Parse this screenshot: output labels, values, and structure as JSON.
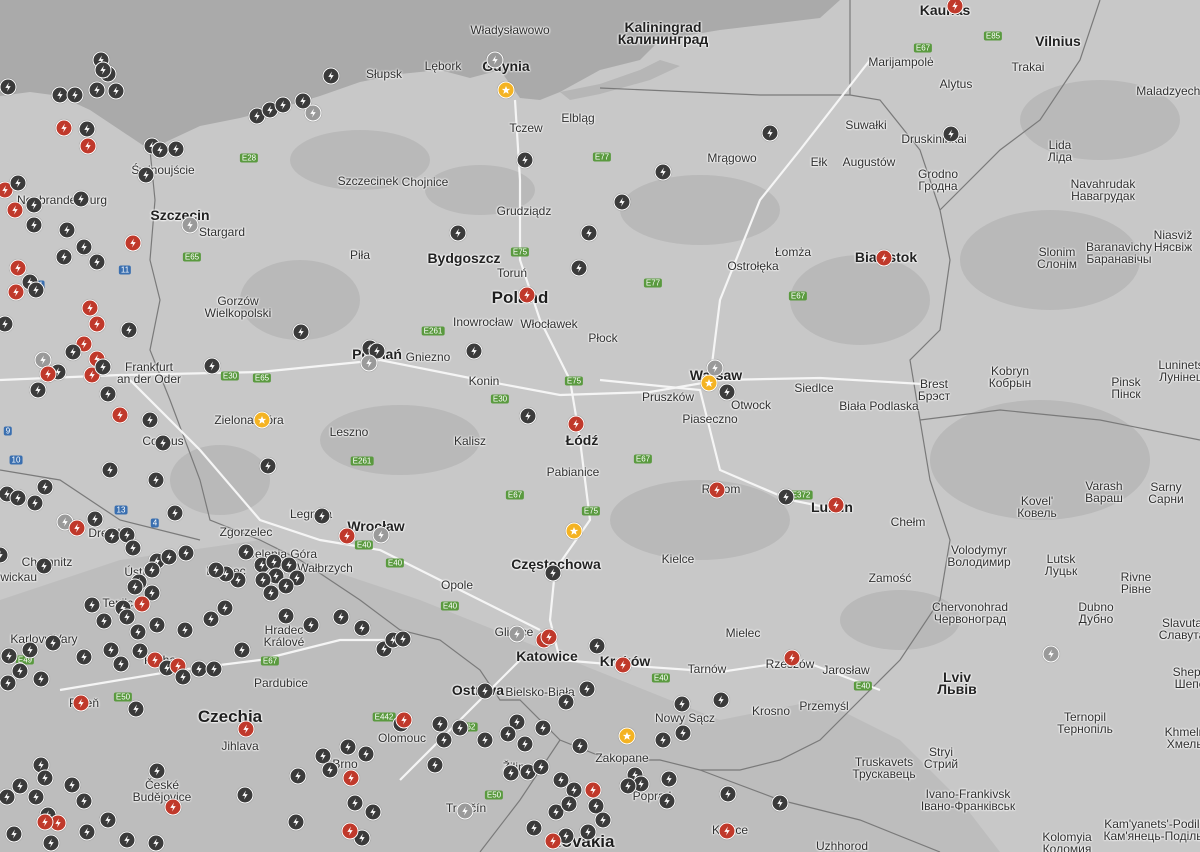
{
  "map": {
    "country_labels": [
      {
        "id": "poland",
        "text": "Poland"
      },
      {
        "id": "czechia",
        "text": "Czechia"
      },
      {
        "id": "slovakia",
        "text": "Slovakia"
      }
    ],
    "city_labels": [
      {
        "id": "wladyslawowo",
        "text": "Władysławowo"
      },
      {
        "id": "kaliningrad",
        "text": "Kaliningrad\nКалининград"
      },
      {
        "id": "vilnius",
        "text": "Vilnius"
      },
      {
        "id": "gdynia",
        "text": "Gdynia"
      },
      {
        "id": "slupsk",
        "text": "Słupsk"
      },
      {
        "id": "lebork",
        "text": "Lębork"
      },
      {
        "id": "elblag",
        "text": "Elbląg"
      },
      {
        "id": "tczew",
        "text": "Tczew"
      },
      {
        "id": "marijampole",
        "text": "Marijampolė"
      },
      {
        "id": "alytus",
        "text": "Alytus"
      },
      {
        "id": "trakai",
        "text": "Trakai"
      },
      {
        "id": "maladzyechna",
        "text": "Maladzyechna"
      },
      {
        "id": "suwalki",
        "text": "Suwałki"
      },
      {
        "id": "druskininkai",
        "text": "Druskininkai"
      },
      {
        "id": "lida",
        "text": "Lida\nЛіда"
      },
      {
        "id": "mragowo",
        "text": "Mrągowo"
      },
      {
        "id": "elk",
        "text": "Ełk"
      },
      {
        "id": "augustow",
        "text": "Augustów"
      },
      {
        "id": "grodno",
        "text": "Grodno\nГродна"
      },
      {
        "id": "navahrudak",
        "text": "Navahrudak\nНавагрудак"
      },
      {
        "id": "szczecinek",
        "text": "Szczecinek"
      },
      {
        "id": "chojnice",
        "text": "Chojnice"
      },
      {
        "id": "grudziadz",
        "text": "Grudziądz"
      },
      {
        "id": "neubrandenburg",
        "text": "Neubrandenburg"
      },
      {
        "id": "swinoujscie",
        "text": "Świnoujście"
      },
      {
        "id": "stargard",
        "text": "Stargard"
      },
      {
        "id": "szczecin",
        "text": "Szczecin"
      },
      {
        "id": "bydgoszcz",
        "text": "Bydgoszcz"
      },
      {
        "id": "torun",
        "text": "Toruń"
      },
      {
        "id": "pila",
        "text": "Piła"
      },
      {
        "id": "ostroleka",
        "text": "Ostrołęka"
      },
      {
        "id": "lomza",
        "text": "Łomża"
      },
      {
        "id": "bialystok",
        "text": "Białystok"
      },
      {
        "id": "slonim",
        "text": "Slonim\nСлонім"
      },
      {
        "id": "baranavichy",
        "text": "Baranavichy\nБаранавічы"
      },
      {
        "id": "niasviz",
        "text": "Niasviž\nНясвіж"
      },
      {
        "id": "gorzow",
        "text": "Gorzów\nWielkopolski"
      },
      {
        "id": "inowroclaw",
        "text": "Inowrocław"
      },
      {
        "id": "wloclawek",
        "text": "Włocławek"
      },
      {
        "id": "plock",
        "text": "Płock"
      },
      {
        "id": "frankfurt",
        "text": "Frankfurt\nan der Oder"
      },
      {
        "id": "poznan",
        "text": "Poznań"
      },
      {
        "id": "gniezno",
        "text": "Gniezno"
      },
      {
        "id": "konin",
        "text": "Konin"
      },
      {
        "id": "warsaw",
        "text": "Warsaw"
      },
      {
        "id": "pruszkow",
        "text": "Pruszków"
      },
      {
        "id": "otwock",
        "text": "Otwock"
      },
      {
        "id": "piaseczno",
        "text": "Piaseczno"
      },
      {
        "id": "siedlce",
        "text": "Siedlce"
      },
      {
        "id": "biala",
        "text": "Biała Podlaska"
      },
      {
        "id": "brest",
        "text": "Brest\nБрэст"
      },
      {
        "id": "kobryn",
        "text": "Kobryn\nКобрын"
      },
      {
        "id": "pinsk",
        "text": "Pinsk\nПінск"
      },
      {
        "id": "luninets",
        "text": "Luninets\nЛунінец"
      },
      {
        "id": "zielona",
        "text": "Zielona Góra"
      },
      {
        "id": "leszno",
        "text": "Leszno"
      },
      {
        "id": "kalisz",
        "text": "Kalisz"
      },
      {
        "id": "lodz",
        "text": "Łódź"
      },
      {
        "id": "pabianice",
        "text": "Pabianice"
      },
      {
        "id": "cottbus",
        "text": "Cottbus"
      },
      {
        "id": "radom",
        "text": "Radom"
      },
      {
        "id": "lublin",
        "text": "Lublin"
      },
      {
        "id": "chelm",
        "text": "Chełm"
      },
      {
        "id": "kovel",
        "text": "Kovel'\nКовель"
      },
      {
        "id": "varash",
        "text": "Varash\nВараш"
      },
      {
        "id": "sarny",
        "text": "Sarny\nСарни"
      },
      {
        "id": "legnica",
        "text": "Legnica"
      },
      {
        "id": "wroclaw",
        "text": "Wrocław"
      },
      {
        "id": "dresden",
        "text": "Dresden"
      },
      {
        "id": "zgorzelec",
        "text": "Zgorzelec"
      },
      {
        "id": "jelenia",
        "text": "Jelenia Góra"
      },
      {
        "id": "walbrzych",
        "text": "Wałbrzych"
      },
      {
        "id": "czestochowa",
        "text": "Częstochowa"
      },
      {
        "id": "kielce",
        "text": "Kielce"
      },
      {
        "id": "zamosc",
        "text": "Zamość"
      },
      {
        "id": "volodymyr",
        "text": "Volodymyr\nВолодимир"
      },
      {
        "id": "lutsk",
        "text": "Lutsk\nЛуцьк"
      },
      {
        "id": "rivne",
        "text": "Rivne\nРівне"
      },
      {
        "id": "chemnitz",
        "text": "Chemnitz"
      },
      {
        "id": "zwickau",
        "text": "Zwickau"
      },
      {
        "id": "usti",
        "text": "Ústí"
      },
      {
        "id": "teplice",
        "text": "Teplice"
      },
      {
        "id": "liberec",
        "text": "Liberec"
      },
      {
        "id": "opole",
        "text": "Opole"
      },
      {
        "id": "chervonohrad",
        "text": "Chervonohrad\nЧервоноград"
      },
      {
        "id": "dubno",
        "text": "Dubno\nДубно"
      },
      {
        "id": "slavuta",
        "text": "Slavuta\nСлавута"
      },
      {
        "id": "karlovy",
        "text": "Karlovy Vary"
      },
      {
        "id": "praha",
        "text": "Praha"
      },
      {
        "id": "hradec",
        "text": "Hradec\nKrálové"
      },
      {
        "id": "gliwice",
        "text": "Gliwice"
      },
      {
        "id": "katowice",
        "text": "Katowice"
      },
      {
        "id": "krakow",
        "text": "Kraków"
      },
      {
        "id": "mielec",
        "text": "Mielec"
      },
      {
        "id": "tarnow",
        "text": "Tarnów"
      },
      {
        "id": "rzeszow",
        "text": "Rzeszów"
      },
      {
        "id": "jaroslaw",
        "text": "Jarosław"
      },
      {
        "id": "lviv",
        "text": "Lviv\nЛьвів"
      },
      {
        "id": "shepetivka",
        "text": "Shepe\nШепе"
      },
      {
        "id": "pardubice",
        "text": "Pardubice"
      },
      {
        "id": "plzen",
        "text": "Plzeň"
      },
      {
        "id": "ostrava",
        "text": "Ostrava"
      },
      {
        "id": "bielsko",
        "text": "Bielsko-Biała"
      },
      {
        "id": "nowysacz",
        "text": "Nowy Sącz"
      },
      {
        "id": "krosno",
        "text": "Krosno"
      },
      {
        "id": "przemysl",
        "text": "Przemyśl"
      },
      {
        "id": "ternopil",
        "text": "Ternopil\nТернопіль"
      },
      {
        "id": "khmelny",
        "text": "Khmelny\nХмельн"
      },
      {
        "id": "jihlava",
        "text": "Jihlava"
      },
      {
        "id": "olomouc",
        "text": "Olomouc"
      },
      {
        "id": "zakopane",
        "text": "Zakopane"
      },
      {
        "id": "stryi",
        "text": "Stryi\nСтрий"
      },
      {
        "id": "truskavets",
        "text": "Truskavets\nТрускавець"
      },
      {
        "id": "brno",
        "text": "Brno"
      },
      {
        "id": "zilina",
        "text": "Žilina"
      },
      {
        "id": "poprad",
        "text": "Poprad"
      },
      {
        "id": "ivano",
        "text": "Ivano-Frankivsk\nІвано-Франківськ"
      },
      {
        "id": "ceske",
        "text": "České\nBudějovice"
      },
      {
        "id": "trencin",
        "text": "Trenčín"
      },
      {
        "id": "kosice",
        "text": "Košice"
      },
      {
        "id": "uzhhorod",
        "text": "Uzhhorod"
      },
      {
        "id": "kamyanets",
        "text": "Kam'yanets'-Podil's\nКам'янець-Подільс"
      },
      {
        "id": "kolomyia",
        "text": "Kolomyia\nКоломия"
      },
      {
        "id": "kaunas",
        "text": "Kaunas"
      }
    ],
    "roads": [
      {
        "id": "e28",
        "text": "E28"
      },
      {
        "id": "e65a",
        "text": "E65"
      },
      {
        "id": "e75a",
        "text": "E75"
      },
      {
        "id": "e77a",
        "text": "E77"
      },
      {
        "id": "e77b",
        "text": "E77"
      },
      {
        "id": "e67a",
        "text": "E67"
      },
      {
        "id": "e85",
        "text": "E85"
      },
      {
        "id": "e67b",
        "text": "E67"
      },
      {
        "id": "e261a",
        "text": "E261"
      },
      {
        "id": "e30a",
        "text": "E30"
      },
      {
        "id": "e65b",
        "text": "E65"
      },
      {
        "id": "e30b",
        "text": "E30"
      },
      {
        "id": "e75b",
        "text": "E75"
      },
      {
        "id": "e261b",
        "text": "E261"
      },
      {
        "id": "e67c",
        "text": "E67"
      },
      {
        "id": "e67d",
        "text": "E67"
      },
      {
        "id": "e75c",
        "text": "E75"
      },
      {
        "id": "e372",
        "text": "E372"
      },
      {
        "id": "e40a",
        "text": "E40"
      },
      {
        "id": "e40b",
        "text": "E40"
      },
      {
        "id": "e40c",
        "text": "E40"
      },
      {
        "id": "e40d",
        "text": "E40"
      },
      {
        "id": "e40e",
        "text": "E40"
      },
      {
        "id": "e67e",
        "text": "E67"
      },
      {
        "id": "e49",
        "text": "E49"
      },
      {
        "id": "e50a",
        "text": "E50"
      },
      {
        "id": "e462",
        "text": "E462"
      },
      {
        "id": "e442",
        "text": "E442"
      },
      {
        "id": "e50b",
        "text": "E50"
      },
      {
        "id": "a11",
        "text": "11"
      },
      {
        "id": "a13",
        "text": "13"
      },
      {
        "id": "a4",
        "text": "4"
      },
      {
        "id": "a9",
        "text": "9"
      },
      {
        "id": "a10",
        "text": "10"
      },
      {
        "id": "a24",
        "text": "24"
      }
    ],
    "legend_colors": {
      "supercharger": "#3b3b3b",
      "supercharger_red": "#c0392b",
      "star": "#f4b323",
      "land": "#c9c9c9",
      "sea": "#a9a9a9"
    }
  }
}
